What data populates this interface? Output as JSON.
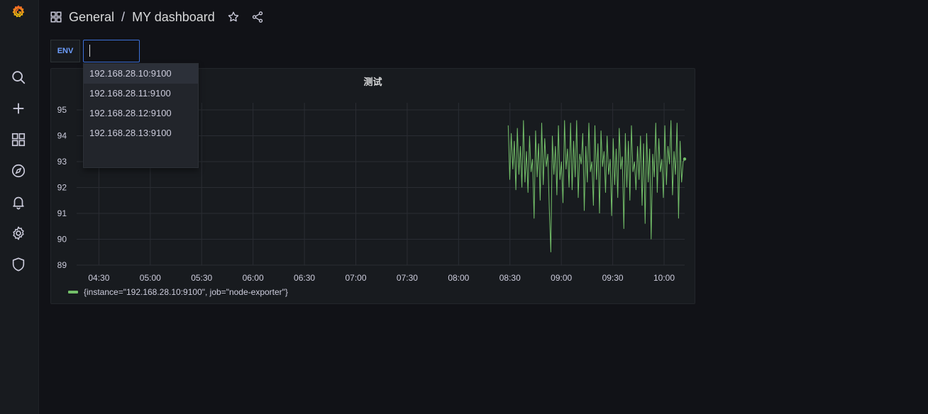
{
  "colors": {
    "background": "#111217",
    "sidebar": "#181b1f",
    "panel": "#181b1f",
    "series": "#73bf69",
    "accent": "#6e9fff",
    "input_border": "#3d71d9"
  },
  "sidebar": {
    "items": [
      {
        "name": "grafana-logo",
        "icon": "grafana-logo-icon"
      },
      {
        "name": "search",
        "icon": "search-icon"
      },
      {
        "name": "create",
        "icon": "plus-icon"
      },
      {
        "name": "dashboards",
        "icon": "dashboards-grid-icon"
      },
      {
        "name": "explore",
        "icon": "compass-icon"
      },
      {
        "name": "alerting",
        "icon": "bell-icon"
      },
      {
        "name": "configuration",
        "icon": "gear-icon"
      },
      {
        "name": "server-admin",
        "icon": "shield-icon"
      }
    ]
  },
  "header": {
    "folder": "General",
    "separator": "/",
    "title": "MY dashboard",
    "star_icon": "star-icon",
    "share_icon": "share-icon"
  },
  "variable": {
    "label": "ENV",
    "value": "",
    "options": [
      "192.168.28.10:9100",
      "192.168.28.11:9100",
      "192.168.28.12:9100",
      "192.168.28.13:9100"
    ],
    "highlighted_index": 0
  },
  "panel": {
    "title": "测试",
    "legend": "{instance=\"192.168.28.10:9100\", job=\"node-exporter\"}"
  },
  "chart_data": {
    "type": "line",
    "title": "测试",
    "xlabel": "",
    "ylabel": "",
    "x_ticks": [
      "04:30",
      "05:00",
      "05:30",
      "06:00",
      "06:30",
      "07:00",
      "07:30",
      "08:00",
      "08:30",
      "09:00",
      "09:30",
      "10:00"
    ],
    "y_ticks": [
      95,
      94,
      93,
      92,
      91,
      90,
      89
    ],
    "ylim": [
      89,
      95
    ],
    "xlim": [
      "04:17",
      "10:12"
    ],
    "grid": true,
    "legend_position": "bottom-left",
    "series": [
      {
        "name": "{instance=\"192.168.28.10:9100\", job=\"node-exporter\"}",
        "color": "#73bf69",
        "start_time": "08:29",
        "end_time": "10:12",
        "values": [
          94.4,
          92.3,
          94.1,
          92.7,
          93.8,
          91.9,
          94.3,
          92.5,
          93.6,
          92.0,
          94.6,
          92.2,
          93.4,
          91.8,
          94.0,
          92.6,
          93.1,
          90.8,
          94.2,
          92.4,
          93.7,
          91.5,
          94.5,
          92.1,
          93.9,
          92.8,
          93.3,
          91.2,
          89.5,
          94.0,
          92.5,
          93.6,
          91.7,
          94.4,
          92.3,
          93.0,
          91.4,
          94.6,
          92.7,
          93.5,
          92.0,
          94.5,
          91.9,
          93.8,
          92.4,
          94.6,
          91.6,
          93.3,
          92.9,
          94.1,
          91.1,
          93.6,
          92.2,
          94.5,
          92.6,
          93.0,
          91.3,
          94.4,
          92.3,
          93.7,
          91.0,
          94.2,
          92.8,
          93.4,
          91.8,
          94.0,
          92.5,
          93.1,
          90.9,
          93.9,
          92.1,
          93.5,
          91.6,
          94.3,
          92.7,
          93.2,
          90.4,
          94.1,
          92.0,
          93.8,
          91.5,
          94.4,
          92.6,
          93.0,
          91.9,
          93.6,
          92.3,
          94.0,
          91.3,
          93.7,
          90.6,
          94.1,
          92.2,
          93.5,
          90.0,
          93.3,
          92.4,
          94.5,
          91.8,
          93.9,
          92.6,
          93.1,
          91.6,
          94.4,
          92.1,
          93.6,
          92.9,
          94.6,
          91.7,
          93.4,
          92.5,
          94.5,
          90.8,
          93.8,
          92.2,
          93.0,
          93.1
        ]
      }
    ]
  }
}
